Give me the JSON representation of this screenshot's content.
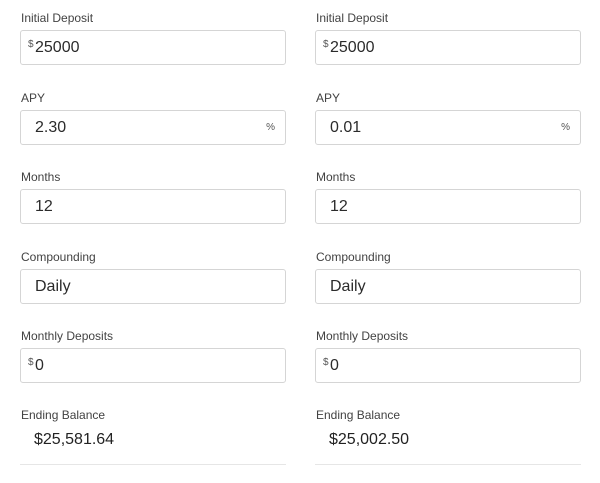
{
  "calculators": [
    {
      "initial_deposit": {
        "label": "Initial Deposit",
        "prefix": "$",
        "value": "25000"
      },
      "apy": {
        "label": "APY",
        "value": "2.30",
        "suffix": "%"
      },
      "months": {
        "label": "Months",
        "value": "12"
      },
      "compounding": {
        "label": "Compounding",
        "value": "Daily"
      },
      "monthly_deposits": {
        "label": "Monthly Deposits",
        "prefix": "$",
        "value": "0"
      },
      "ending_balance": {
        "label": "Ending Balance",
        "value": "$25,581.64"
      }
    },
    {
      "initial_deposit": {
        "label": "Initial Deposit",
        "prefix": "$",
        "value": "25000"
      },
      "apy": {
        "label": "APY",
        "value": "0.01",
        "suffix": "%"
      },
      "months": {
        "label": "Months",
        "value": "12"
      },
      "compounding": {
        "label": "Compounding",
        "value": "Daily"
      },
      "monthly_deposits": {
        "label": "Monthly Deposits",
        "prefix": "$",
        "value": "0"
      },
      "ending_balance": {
        "label": "Ending Balance",
        "value": "$25,002.50"
      }
    }
  ]
}
